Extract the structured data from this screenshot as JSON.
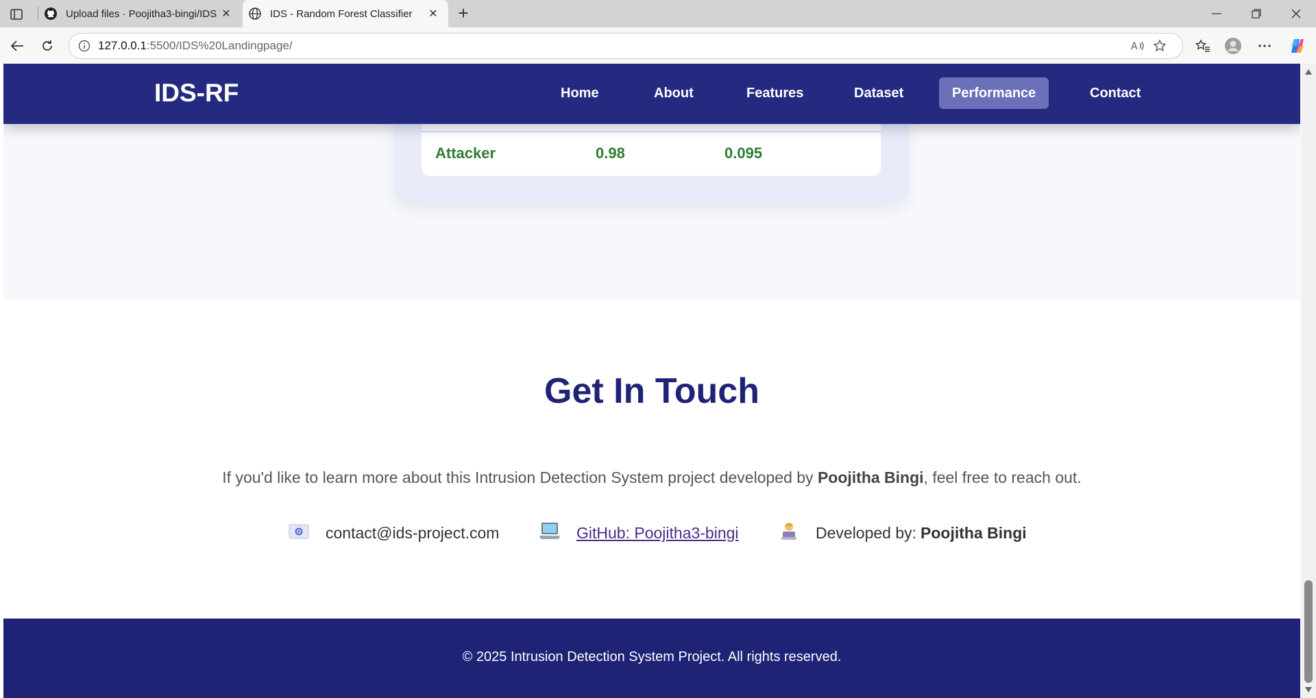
{
  "browser": {
    "tabs": [
      {
        "title": "Upload files · Poojitha3-bingi/IDS",
        "icon": "github-icon",
        "active": false
      },
      {
        "title": "IDS - Random Forest Classifier",
        "icon": "globe-icon",
        "active": true
      }
    ],
    "url_host": "127.0.0.1",
    "url_rest": ":5500/IDS%20Landingpage/"
  },
  "nav": {
    "brand": "IDS-RF",
    "links": [
      {
        "label": "Home",
        "active": false
      },
      {
        "label": "About",
        "active": false
      },
      {
        "label": "Features",
        "active": false
      },
      {
        "label": "Dataset",
        "active": false
      },
      {
        "label": "Performance",
        "active": true
      },
      {
        "label": "Contact",
        "active": false
      }
    ]
  },
  "performance": {
    "row": {
      "label": "Attacker",
      "value1": "0.98",
      "value2": "0.095"
    }
  },
  "contact": {
    "title": "Get In Touch",
    "desc_prefix": "If you'd like to learn more about this Intrusion Detection System project developed by ",
    "desc_name": "Poojitha Bingi",
    "desc_suffix": ", feel free to reach out.",
    "email": "contact@ids-project.com",
    "github": "GitHub: Poojitha3-bingi",
    "developed_label": "Developed by: ",
    "developed_name": "Poojitha Bingi",
    "icons": {
      "email": "email-icon",
      "github": "laptop-icon",
      "developer": "developer-icon"
    }
  },
  "footer": {
    "text": "© 2025 Intrusion Detection System Project. All rights reserved."
  },
  "colors": {
    "nav_bg": "#242a80",
    "nav_active": "#6b70b8",
    "footer_bg": "#1e2375",
    "title": "#1e2375",
    "metric_green": "#2e7d32"
  }
}
